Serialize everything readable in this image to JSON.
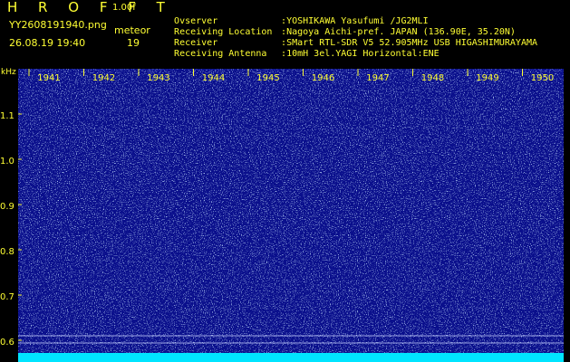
{
  "header": {
    "title": "H R O F F T",
    "version": "1.00f",
    "filename": "YY2608191940.png",
    "meteor_label": "meteor",
    "timestamp": "26.08.19 19:40",
    "meteor_count": "19"
  },
  "metadata": [
    {
      "key": "Ovserver",
      "value": ":YOSHIKAWA Yasufumi /JG2MLI"
    },
    {
      "key": "Receiving Location",
      "value": ":Nagoya Aichi-pref. JAPAN (136.90E, 35.20N)"
    },
    {
      "key": "Receiver",
      "value": ":SMart RTL-SDR V5 52.905MHz USB HIGASHIMURAYAMA"
    },
    {
      "key": "Receiving Antenna",
      "value": ":10mH 3el.YAGI Horizontal:ENE"
    }
  ],
  "axis": {
    "y_unit": "kHz",
    "y_ticks": [
      "1.1",
      "1.0",
      "0.9",
      "0.8",
      "0.7",
      "0.6"
    ],
    "x_ticks": [
      "1941",
      "1942",
      "1943",
      "1944",
      "1945",
      "1946",
      "1947",
      "1948",
      "1949",
      "1950"
    ]
  },
  "colors": {
    "background": "#000000",
    "text": "#ffff33",
    "noise_bg": "#0a0f8c",
    "baseline": "#00e5ff"
  }
}
